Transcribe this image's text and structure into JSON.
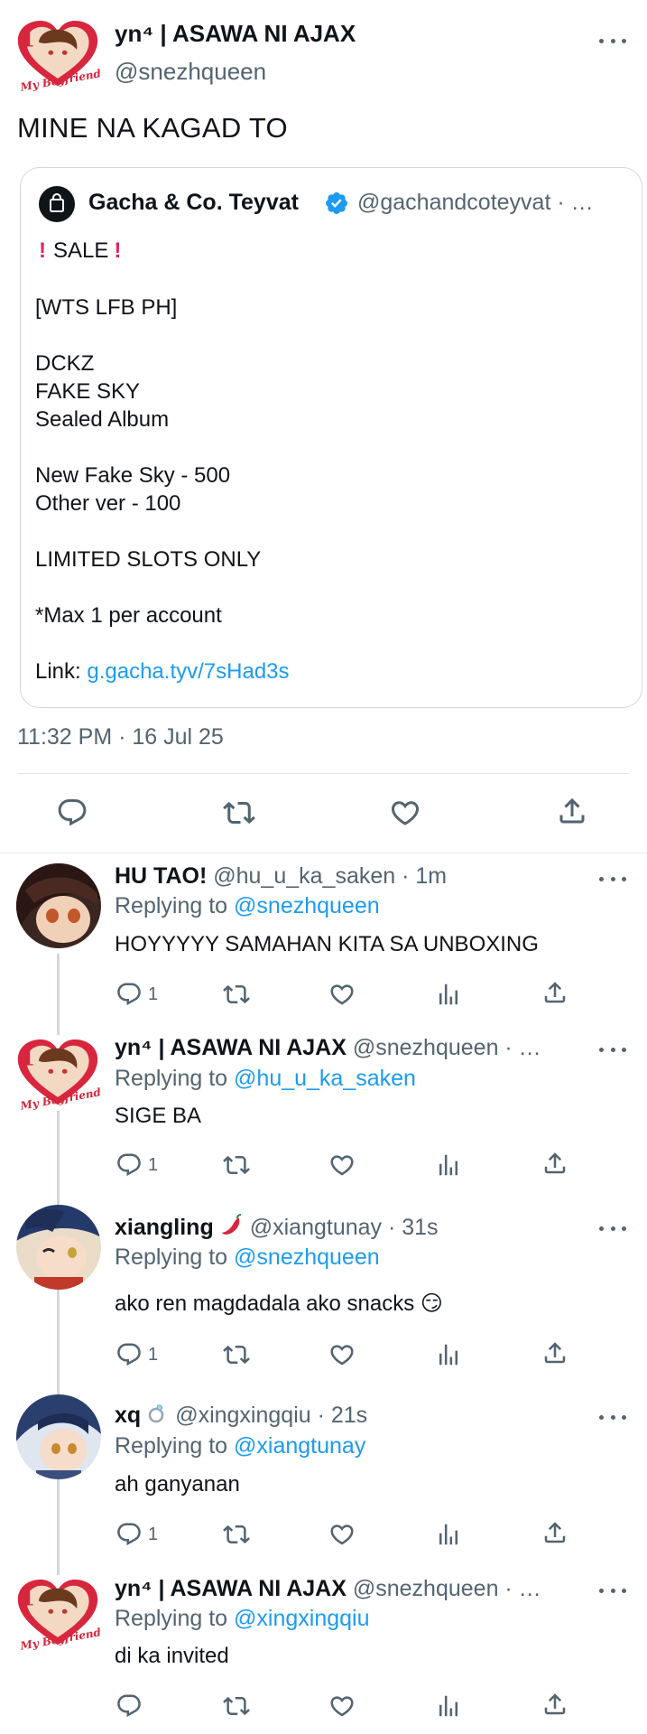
{
  "main_tweet": {
    "display_name": "yn⁴ | ASAWA NI AJAX",
    "handle": "@snezhqueen",
    "text": "MINE NA KAGAD TO",
    "timestamp": "11:32 PM · 16 Jul 25",
    "avatar_caption": "My Boyfriend"
  },
  "quote": {
    "display_name": "Gacha & Co. Teyvat",
    "handle": "@gachandcoteyvat · …",
    "sale_line": "SALE",
    "body": "[WTS LFB PH]\n\nDCKZ\nFAKE SKY\nSealed Album\n\nNew Fake Sky - 500\nOther ver - 100\n\nLIMITED SLOTS ONLY\n\n*Max 1 per account",
    "link_label": "Link: ",
    "link_url": "g.gacha.tyv/7sHad3s"
  },
  "replies": [
    {
      "display_name": "HU TAO!",
      "handle_time": "@hu_u_ka_saken · 1m",
      "replying_label": "Replying to ",
      "replying_to": "@snezhqueen",
      "text": "HOYYYYY SAMAHAN KITA SA UNBOXING",
      "reply_count": "1"
    },
    {
      "display_name": "yn⁴ | ASAWA NI AJAX",
      "handle_time": "@snezhqueen · …",
      "replying_label": "Replying to ",
      "replying_to": "@hu_u_ka_saken",
      "text": "SIGE BA",
      "reply_count": "1"
    },
    {
      "display_name": "xiangling",
      "handle_time": "@xiangtunay · 31s",
      "replying_label": "Replying to ",
      "replying_to": "@snezhqueen",
      "text": "ako ren magdadala ako snacks 😏",
      "reply_count": "1"
    },
    {
      "display_name": "xq",
      "handle_time": "@xingxingqiu · 21s",
      "replying_label": "Replying to ",
      "replying_to": "@xiangtunay",
      "text": "ah ganyanan",
      "reply_count": "1"
    },
    {
      "display_name": "yn⁴ | ASAWA NI AJAX",
      "handle_time": "@snezhqueen · …",
      "replying_label": "Replying to ",
      "replying_to": "@xingxingqiu",
      "text": "di ka invited",
      "reply_count": ""
    }
  ],
  "colors": {
    "accent": "#1d9bf0",
    "secondary_text": "#536471",
    "heart_red": "#d7263d"
  }
}
